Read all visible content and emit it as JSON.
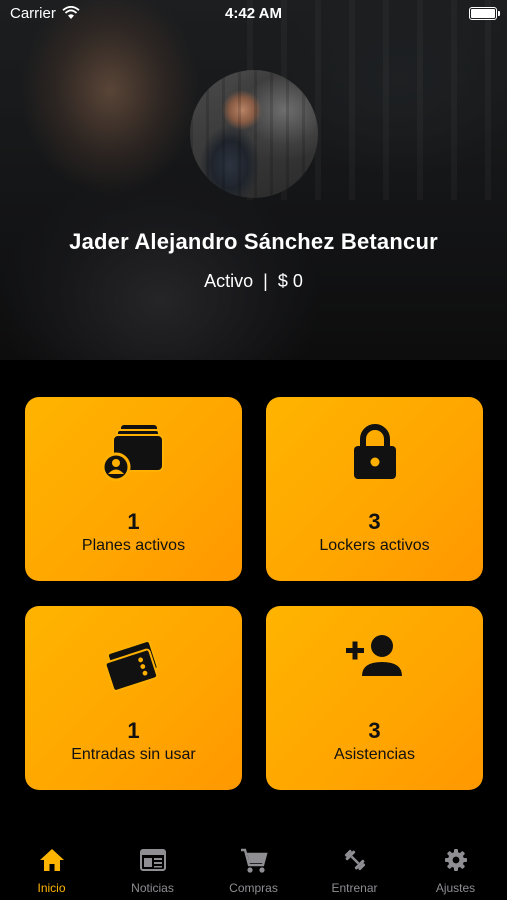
{
  "status_bar": {
    "carrier": "Carrier",
    "time": "4:42 AM"
  },
  "profile": {
    "name": "Jader Alejandro Sánchez Betancur",
    "status": "Activo",
    "separator": "|",
    "balance": "$ 0"
  },
  "cards": [
    {
      "count": "1",
      "label": "Planes activos",
      "icon": "wallet-user-icon"
    },
    {
      "count": "3",
      "label": "Lockers activos",
      "icon": "lock-icon"
    },
    {
      "count": "1",
      "label": "Entradas sin usar",
      "icon": "ticket-icon"
    },
    {
      "count": "3",
      "label": "Asistencias",
      "icon": "person-add-icon"
    }
  ],
  "tabs": [
    {
      "label": "Inicio",
      "icon": "home-icon",
      "active": true
    },
    {
      "label": "Noticias",
      "icon": "newspaper-icon",
      "active": false
    },
    {
      "label": "Compras",
      "icon": "cart-icon",
      "active": false
    },
    {
      "label": "Entrenar",
      "icon": "dumbbell-icon",
      "active": false
    },
    {
      "label": "Ajustes",
      "icon": "gear-icon",
      "active": false
    }
  ],
  "colors": {
    "accent": "#ffb400",
    "card_bg": "#ffa500",
    "background": "#000000",
    "tab_inactive": "#8e8e93"
  }
}
